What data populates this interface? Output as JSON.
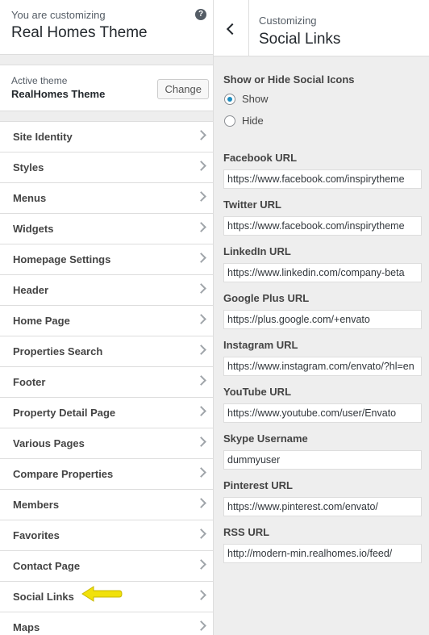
{
  "left": {
    "customizing_label": "You are customizing",
    "customizing_title": "Real Homes Theme",
    "help_glyph": "?",
    "theme": {
      "label": "Active theme",
      "name": "RealHomes Theme",
      "change_label": "Change"
    },
    "sections": [
      "Site Identity",
      "Styles",
      "Menus",
      "Widgets",
      "Homepage Settings",
      "Header",
      "Home Page",
      "Properties Search",
      "Footer",
      "Property Detail Page",
      "Various Pages",
      "Compare Properties",
      "Members",
      "Favorites",
      "Contact Page",
      "Social Links",
      "Maps"
    ],
    "annotation_color": "#f1e10a"
  },
  "right": {
    "customizing_label": "Customizing",
    "title": "Social Links",
    "show_hide": {
      "title": "Show or Hide Social Icons",
      "options": [
        "Show",
        "Hide"
      ],
      "selected": "Show"
    },
    "fields": [
      {
        "label": "Facebook URL",
        "value": "https://www.facebook.com/inspirytheme"
      },
      {
        "label": "Twitter URL",
        "value": "https://www.facebook.com/inspirytheme"
      },
      {
        "label": "LinkedIn URL",
        "value": "https://www.linkedin.com/company-beta"
      },
      {
        "label": "Google Plus URL",
        "value": "https://plus.google.com/+envato"
      },
      {
        "label": "Instagram URL",
        "value": "https://www.instagram.com/envato/?hl=en"
      },
      {
        "label": "YouTube URL",
        "value": "https://www.youtube.com/user/Envato"
      },
      {
        "label": "Skype Username",
        "value": "dummyuser"
      },
      {
        "label": "Pinterest URL",
        "value": "https://www.pinterest.com/envato/"
      },
      {
        "label": "RSS URL",
        "value": "http://modern-min.realhomes.io/feed/"
      }
    ],
    "accent_color": "#1e8cbe"
  }
}
